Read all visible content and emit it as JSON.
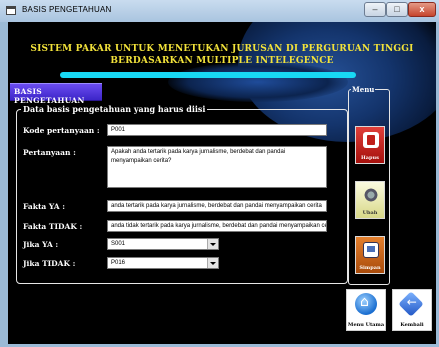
{
  "window": {
    "title": "BASIS PENGETAHUAN",
    "min": "–",
    "max": "□",
    "close": "x"
  },
  "app": {
    "title_line1": "SISTEM PAKAR UNTUK MENETUKAN JURUSAN DI PERGURUAN TINGGI",
    "title_line2": "BERDASARKAN MULTIPLE INTELEGENCE"
  },
  "section": {
    "header": "BASIS PENGETAHUAN",
    "legend": "Data basis pengetahuan yang harus diisi"
  },
  "form": {
    "kode_label": "Kode pertanyaan :",
    "kode_value": "P001",
    "pertanyaan_label": "Pertanyaan :",
    "pertanyaan_value": "Apakah anda tertarik pada karya jurnalisme, berdebat dan pandai menyampaikan cerita?",
    "fakta_ya_label": "Fakta YA :",
    "fakta_ya_value": "anda tertarik pada karya jurnalisme, berdebat dan pandai menyampaikan cerita",
    "fakta_tidak_label": "Fakta TIDAK :",
    "fakta_tidak_value": "anda tidak tertarik pada karya jurnalisme, berdebat dan pandai menyampaikan cer",
    "jika_ya_label": "Jika YA :",
    "jika_ya_value": "S001",
    "jika_tidak_label": "Jika TIDAK :",
    "jika_tidak_value": "P016"
  },
  "menu": {
    "legend": "Menu",
    "hapus": "Hapus",
    "ubah": "Ubah",
    "simpan": "Simpan"
  },
  "nav": {
    "home": "Menu Utama",
    "back": "Kembali"
  },
  "colors": {
    "title": "#f2e23a",
    "accent_bar": "#18d8f4",
    "header_bg": "#5a3ee6"
  }
}
